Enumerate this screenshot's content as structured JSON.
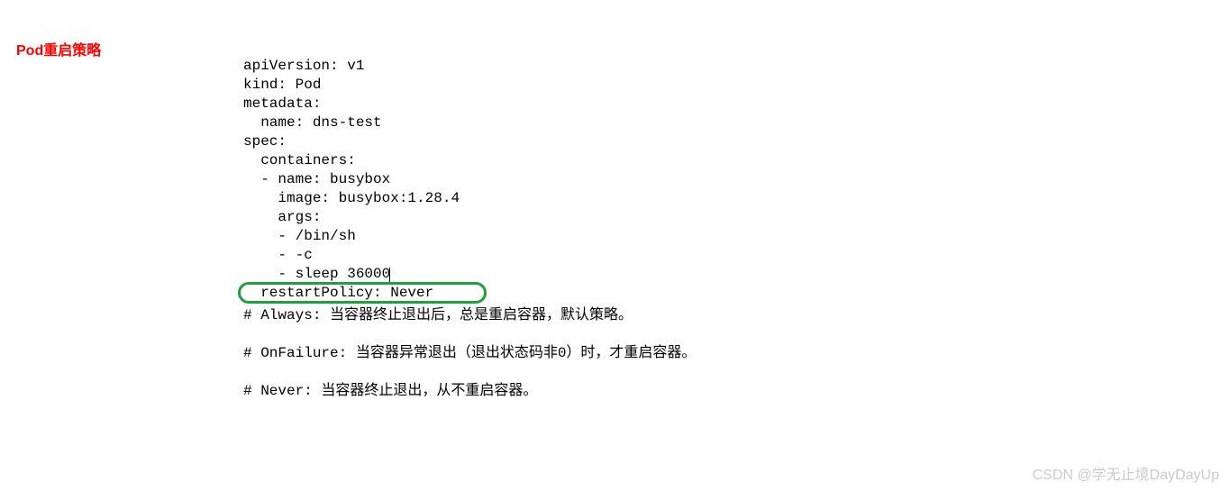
{
  "heading": "Pod重启策略",
  "yaml": {
    "line1": "apiVersion: v1",
    "line2": "kind: Pod",
    "line3": "metadata:",
    "line4": "  name: dns-test",
    "line5": "spec:",
    "line6": "  containers:",
    "line7": "  - name: busybox",
    "line8": "    image: busybox:1.28.4",
    "line9": "    args:",
    "line10": "    - /bin/sh",
    "line11": "    - -c",
    "line12": "    - sleep 36000",
    "line13": "  restartPolicy: Never"
  },
  "comments": {
    "always": "# Always: 当容器终止退出后，总是重启容器，默认策略。",
    "onFailure": "# OnFailure: 当容器异常退出（退出状态码非0）时，才重启容器。",
    "never": "# Never: 当容器终止退出，从不重启容器。"
  },
  "watermark": "CSDN @学无止境DayDayUp"
}
